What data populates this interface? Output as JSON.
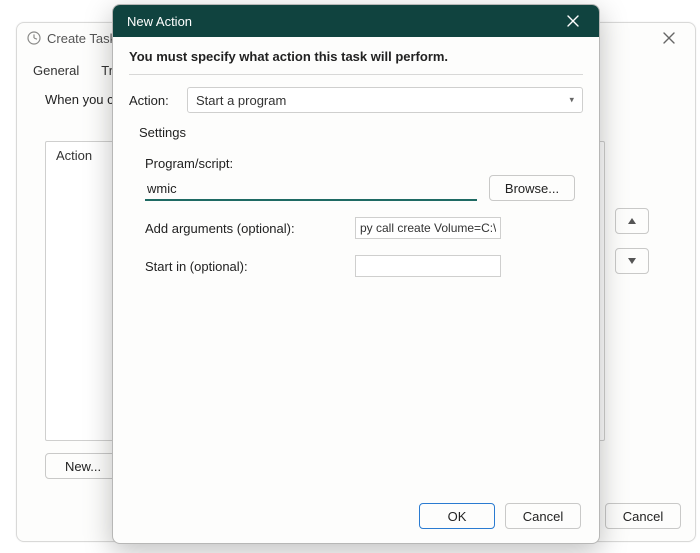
{
  "outer": {
    "title": "Create Task",
    "tabs": {
      "general": "General",
      "triggers": "Trig"
    },
    "hint_fragment": "When you c",
    "action_header": "Action",
    "new_button": "New...",
    "cancel_button": "Cancel"
  },
  "modal": {
    "title": "New Action",
    "hint": "You must specify what action this task will perform.",
    "action_label": "Action:",
    "action_value": "Start a program",
    "settings_label": "Settings",
    "program_label": "Program/script:",
    "program_value": "wmic",
    "browse_button": "Browse...",
    "args_label": "Add arguments (optional):",
    "args_value": "py call create Volume=C:\\",
    "startin_label": "Start in (optional):",
    "startin_value": "",
    "ok_button": "OK",
    "cancel_button": "Cancel"
  }
}
